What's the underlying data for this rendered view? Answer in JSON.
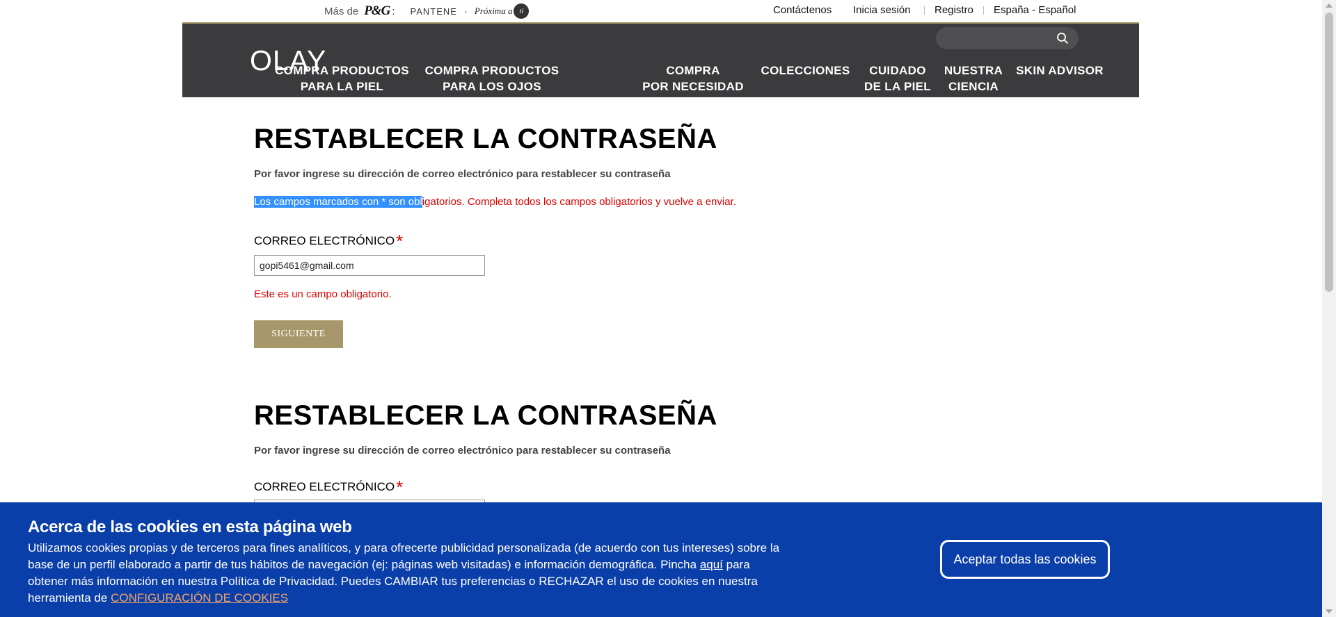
{
  "topbar": {
    "mas_de": "Más de",
    "pg": "P&G",
    "colon": ":",
    "pantene": "PANTENE",
    "dot": "·",
    "proxima": "Próxima a",
    "proxima_ti": "ti",
    "contact": "Contáctenos",
    "login": "Inicia sesión",
    "register": "Registro",
    "locale": "España - Español"
  },
  "nav": {
    "logo": "OLAY",
    "items": [
      {
        "line1": "COMPRA PRODUCTOS",
        "line2": "PARA LA PIEL"
      },
      {
        "line1": "COMPRA PRODUCTOS",
        "line2": "PARA LOS OJOS"
      },
      {
        "line1": "COMPRA",
        "line2": "POR NECESIDAD"
      },
      {
        "line1": "COLECCIONES",
        "line2": ""
      },
      {
        "line1": "CUIDADO",
        "line2": "DE LA PIEL"
      },
      {
        "line1": "NUESTRA",
        "line2": "CIENCIA"
      },
      {
        "line1": "SKIN ADVISOR",
        "line2": ""
      }
    ]
  },
  "form1": {
    "title": "RESTABLECER LA CONTRASEÑA",
    "description": "Por favor ingrese su dirección de correo electrónico para restablecer su contraseña",
    "required_note_selected": "Los campos marcados con * son obl",
    "required_note_rest": "igatorios. Completa todos los campos obligatorios y vuelve a enviar.",
    "email_label": "CORREO ELECTRÓNICO",
    "required_mark": "*",
    "email_value": "gopi5461@gmail.com",
    "error": "Este es un campo obligatorio.",
    "submit": "SIGUIENTE"
  },
  "form2": {
    "title": "RESTABLECER LA CONTRASEÑA",
    "description": "Por favor ingrese su dirección de correo electrónico para restablecer su contraseña",
    "email_label": "CORREO ELECTRÓNICO",
    "required_mark": "*"
  },
  "cookie": {
    "title": "Acerca de las cookies en esta página web",
    "text_1": "Utilizamos cookies propias y de terceros para fines analíticos, y para ofrecerte publicidad personalizada (de acuerdo con tus intereses) sobre la base de un perfil elaborado a partir de tus hábitos de navegación (ej: páginas web visitadas) e información demográfica. Pincha ",
    "aqui": "aquí",
    "text_2": " para obtener más información en nuestra Política de Privacidad. Puedes CAMBIAR tus preferencias o RECHAZAR el uso de cookies en nuestra herramienta de ",
    "config_link": "CONFIGURACIÓN DE COOKIES",
    "accept": "Aceptar todas las cookies"
  },
  "colors": {
    "nav_bg": "#3b3b3d",
    "gold": "#a8976a",
    "error_red": "#e00000",
    "cookie_bg": "#0a3ea8",
    "selection": "#3390ff"
  }
}
